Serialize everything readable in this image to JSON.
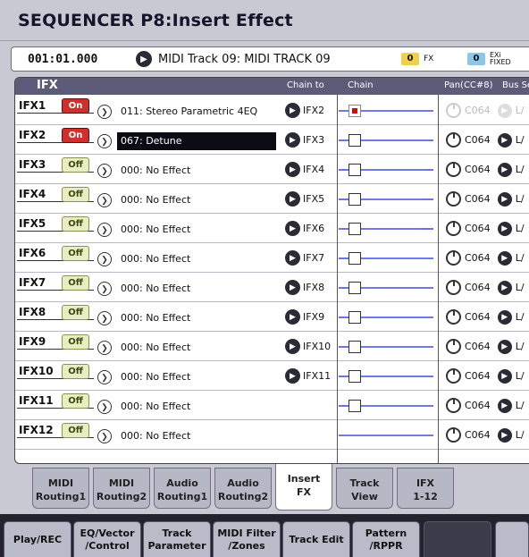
{
  "title": "SEQUENCER P8:Insert Effect",
  "location": {
    "position": "001:01.000",
    "track": "MIDI Track 09: MIDI TRACK 09",
    "fx_badge": {
      "value": "0",
      "label": "FX"
    },
    "exi_badge": {
      "value": "0",
      "label_top": "EXi",
      "label_bottom": "FIXED"
    }
  },
  "header": {
    "ifx": "IFX",
    "chain_to": "Chain to",
    "chain": "Chain",
    "pan": "Pan(CC#8)",
    "bus": "Bus Se"
  },
  "ifx_rows": [
    {
      "label": "IFX1",
      "state": "On",
      "effect": "011: Stereo Parametric 4EQ",
      "chain_to": "IFX2",
      "pan": "C064",
      "bus": "L/",
      "chain_on": true,
      "selected": false,
      "pan_dim": true
    },
    {
      "label": "IFX2",
      "state": "On",
      "effect": "067: Detune",
      "chain_to": "IFX3",
      "pan": "C064",
      "bus": "L/",
      "chain_on": false,
      "selected": true,
      "pan_dim": false
    },
    {
      "label": "IFX3",
      "state": "Off",
      "effect": "000: No Effect",
      "chain_to": "IFX4",
      "pan": "C064",
      "bus": "L/",
      "chain_on": false,
      "selected": false,
      "pan_dim": false
    },
    {
      "label": "IFX4",
      "state": "Off",
      "effect": "000: No Effect",
      "chain_to": "IFX5",
      "pan": "C064",
      "bus": "L/",
      "chain_on": false,
      "selected": false,
      "pan_dim": false
    },
    {
      "label": "IFX5",
      "state": "Off",
      "effect": "000: No Effect",
      "chain_to": "IFX6",
      "pan": "C064",
      "bus": "L/",
      "chain_on": false,
      "selected": false,
      "pan_dim": false
    },
    {
      "label": "IFX6",
      "state": "Off",
      "effect": "000: No Effect",
      "chain_to": "IFX7",
      "pan": "C064",
      "bus": "L/",
      "chain_on": false,
      "selected": false,
      "pan_dim": false
    },
    {
      "label": "IFX7",
      "state": "Off",
      "effect": "000: No Effect",
      "chain_to": "IFX8",
      "pan": "C064",
      "bus": "L/",
      "chain_on": false,
      "selected": false,
      "pan_dim": false
    },
    {
      "label": "IFX8",
      "state": "Off",
      "effect": "000: No Effect",
      "chain_to": "IFX9",
      "pan": "C064",
      "bus": "L/",
      "chain_on": false,
      "selected": false,
      "pan_dim": false
    },
    {
      "label": "IFX9",
      "state": "Off",
      "effect": "000: No Effect",
      "chain_to": "IFX10",
      "pan": "C064",
      "bus": "L/",
      "chain_on": false,
      "selected": false,
      "pan_dim": false
    },
    {
      "label": "IFX10",
      "state": "Off",
      "effect": "000: No Effect",
      "chain_to": "IFX11",
      "pan": "C064",
      "bus": "L/",
      "chain_on": false,
      "selected": false,
      "pan_dim": false
    },
    {
      "label": "IFX11",
      "state": "Off",
      "effect": "000: No Effect",
      "chain_to": "",
      "pan": "C064",
      "bus": "L/",
      "chain_on": false,
      "selected": false,
      "pan_dim": false
    },
    {
      "label": "IFX12",
      "state": "Off",
      "effect": "000: No Effect",
      "chain_to": "",
      "pan": "C064",
      "bus": "L/",
      "chain_on": false,
      "selected": false,
      "pan_dim": false
    }
  ],
  "tabs": [
    {
      "line1": "MIDI",
      "line2": "Routing1"
    },
    {
      "line1": "MIDI",
      "line2": "Routing2"
    },
    {
      "line1": "Audio",
      "line2": "Routing1"
    },
    {
      "line1": "Audio",
      "line2": "Routing2"
    },
    {
      "line1": "Insert",
      "line2": "FX"
    },
    {
      "line1": "Track",
      "line2": "View"
    },
    {
      "line1": "IFX",
      "line2": "1-12"
    }
  ],
  "bottom_tabs": [
    {
      "line1": "Play/REC",
      "line2": ""
    },
    {
      "line1": "EQ/Vector",
      "line2": "/Control"
    },
    {
      "line1": "Track",
      "line2": "Parameter"
    },
    {
      "line1": "MIDI Filter",
      "line2": "/Zones"
    },
    {
      "line1": "Track Edit",
      "line2": ""
    },
    {
      "line1": "Pattern",
      "line2": "/RPPR"
    }
  ],
  "colors": {
    "on": "#d0302c",
    "off": "#e9edc4",
    "chain_line": "#1a2bd6",
    "header": "#5c5c78"
  }
}
